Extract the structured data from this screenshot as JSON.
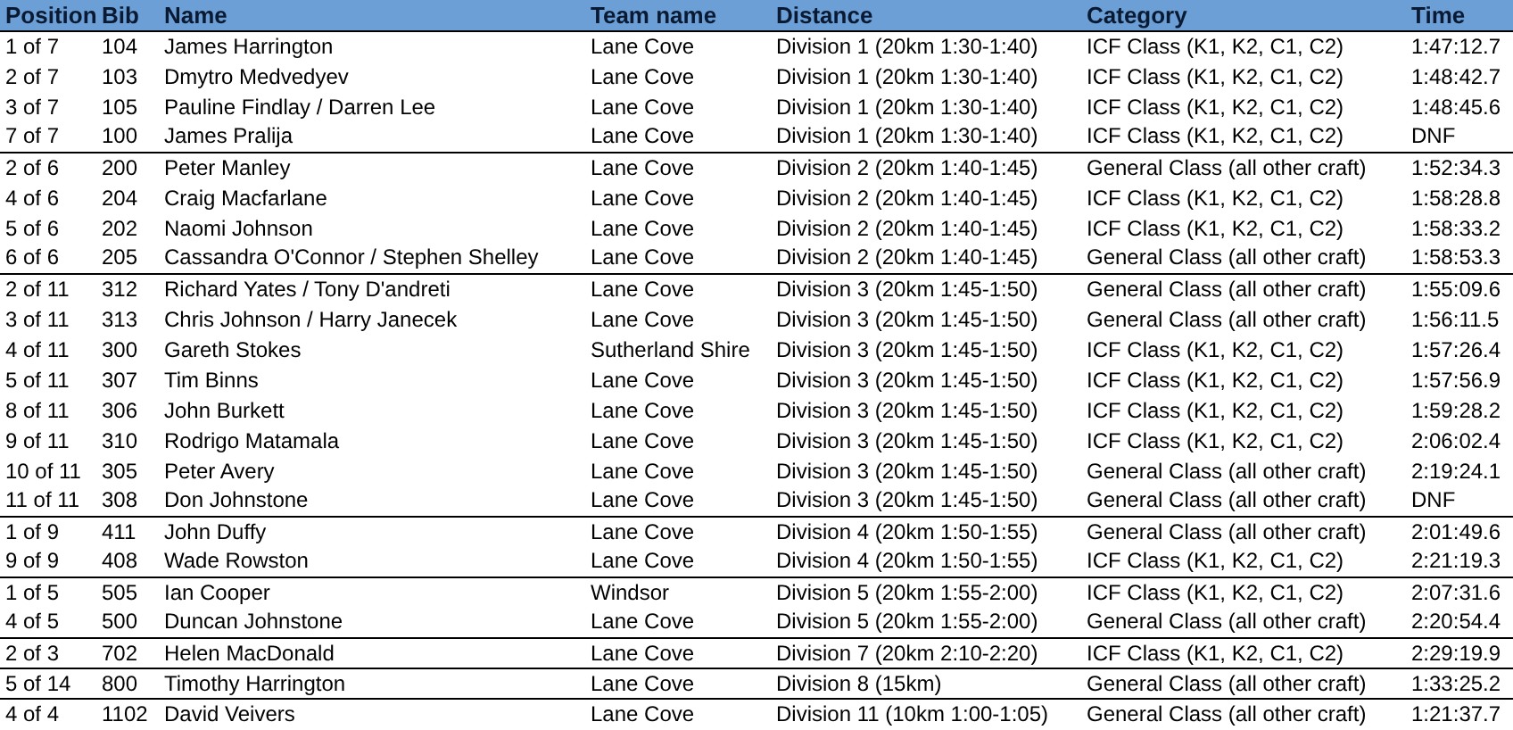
{
  "table": {
    "columns": [
      "Position",
      "Bib",
      "Name",
      "Team name",
      "Distance",
      "Category",
      "Time"
    ],
    "groups": [
      {
        "rows": [
          [
            "1 of 7",
            "104",
            "James Harrington",
            "Lane Cove",
            "Division 1 (20km 1:30-1:40)",
            "ICF Class (K1, K2, C1, C2)",
            "1:47:12.7"
          ],
          [
            "2 of 7",
            "103",
            "Dmytro Medvedyev",
            "Lane Cove",
            "Division 1 (20km 1:30-1:40)",
            "ICF Class (K1, K2, C1, C2)",
            "1:48:42.7"
          ],
          [
            "3 of 7",
            "105",
            "Pauline Findlay / Darren Lee",
            "Lane Cove",
            "Division 1 (20km 1:30-1:40)",
            "ICF Class (K1, K2, C1, C2)",
            "1:48:45.6"
          ],
          [
            "7 of 7",
            "100",
            "James Pralija",
            "Lane Cove",
            "Division 1 (20km 1:30-1:40)",
            "ICF Class (K1, K2, C1, C2)",
            "DNF"
          ]
        ]
      },
      {
        "rows": [
          [
            "2 of 6",
            "200",
            "Peter Manley",
            "Lane Cove",
            "Division 2 (20km 1:40-1:45)",
            "General Class (all other craft)",
            "1:52:34.3"
          ],
          [
            "4 of 6",
            "204",
            "Craig Macfarlane",
            "Lane Cove",
            "Division 2 (20km 1:40-1:45)",
            "ICF Class (K1, K2, C1, C2)",
            "1:58:28.8"
          ],
          [
            "5 of 6",
            "202",
            "Naomi Johnson",
            "Lane Cove",
            "Division 2 (20km 1:40-1:45)",
            "ICF Class (K1, K2, C1, C2)",
            "1:58:33.2"
          ],
          [
            "6 of 6",
            "205",
            "Cassandra O'Connor / Stephen Shelley",
            "Lane Cove",
            "Division 2 (20km 1:40-1:45)",
            "General Class (all other craft)",
            "1:58:53.3"
          ]
        ]
      },
      {
        "rows": [
          [
            "2 of 11",
            "312",
            "Richard Yates / Tony D'andreti",
            "Lane Cove",
            "Division 3 (20km 1:45-1:50)",
            "General Class (all other craft)",
            "1:55:09.6"
          ],
          [
            "3 of 11",
            "313",
            "Chris Johnson / Harry Janecek",
            "Lane Cove",
            "Division 3 (20km 1:45-1:50)",
            "General Class (all other craft)",
            "1:56:11.5"
          ],
          [
            "4 of 11",
            "300",
            "Gareth Stokes",
            "Sutherland Shire",
            "Division 3 (20km 1:45-1:50)",
            "ICF Class (K1, K2, C1, C2)",
            "1:57:26.4"
          ],
          [
            "5 of 11",
            "307",
            "Tim Binns",
            "Lane Cove",
            "Division 3 (20km 1:45-1:50)",
            "ICF Class (K1, K2, C1, C2)",
            "1:57:56.9"
          ],
          [
            "8 of 11",
            "306",
            "John Burkett",
            "Lane Cove",
            "Division 3 (20km 1:45-1:50)",
            "ICF Class (K1, K2, C1, C2)",
            "1:59:28.2"
          ],
          [
            "9 of 11",
            "310",
            "Rodrigo Matamala",
            "Lane Cove",
            "Division 3 (20km 1:45-1:50)",
            "ICF Class (K1, K2, C1, C2)",
            "2:06:02.4"
          ],
          [
            "10 of 11",
            "305",
            "Peter Avery",
            "Lane Cove",
            "Division 3 (20km 1:45-1:50)",
            "General Class (all other craft)",
            "2:19:24.1"
          ],
          [
            "11 of 11",
            "308",
            "Don Johnstone",
            "Lane Cove",
            "Division 3 (20km 1:45-1:50)",
            "General Class (all other craft)",
            "DNF"
          ]
        ]
      },
      {
        "rows": [
          [
            "1 of 9",
            "411",
            "John Duffy",
            "Lane Cove",
            "Division 4 (20km 1:50-1:55)",
            "General Class (all other craft)",
            "2:01:49.6"
          ],
          [
            "9 of 9",
            "408",
            "Wade Rowston",
            "Lane Cove",
            "Division 4 (20km 1:50-1:55)",
            "ICF Class (K1, K2, C1, C2)",
            "2:21:19.3"
          ]
        ]
      },
      {
        "rows": [
          [
            "1 of 5",
            "505",
            "Ian Cooper",
            "Windsor",
            "Division 5 (20km 1:55-2:00)",
            "ICF Class (K1, K2, C1, C2)",
            "2:07:31.6"
          ],
          [
            "4 of 5",
            "500",
            "Duncan Johnstone",
            "Lane Cove",
            "Division 5 (20km 1:55-2:00)",
            "General Class (all other craft)",
            "2:20:54.4"
          ]
        ]
      },
      {
        "rows": [
          [
            "2 of 3",
            "702",
            "Helen MacDonald",
            "Lane Cove",
            "Division 7 (20km 2:10-2:20)",
            "ICF Class (K1, K2, C1, C2)",
            "2:29:19.9"
          ]
        ]
      },
      {
        "rows": [
          [
            "5 of 14",
            "800",
            "Timothy Harrington",
            "Lane Cove",
            "Division 8 (15km)",
            "General Class (all other craft)",
            "1:33:25.2"
          ]
        ]
      },
      {
        "rows": [
          [
            "4 of 4",
            "1102",
            "David Veivers",
            "Lane Cove",
            "Division 11 (10km 1:00-1:05)",
            "General Class (all other craft)",
            "1:21:37.7"
          ]
        ]
      }
    ]
  }
}
